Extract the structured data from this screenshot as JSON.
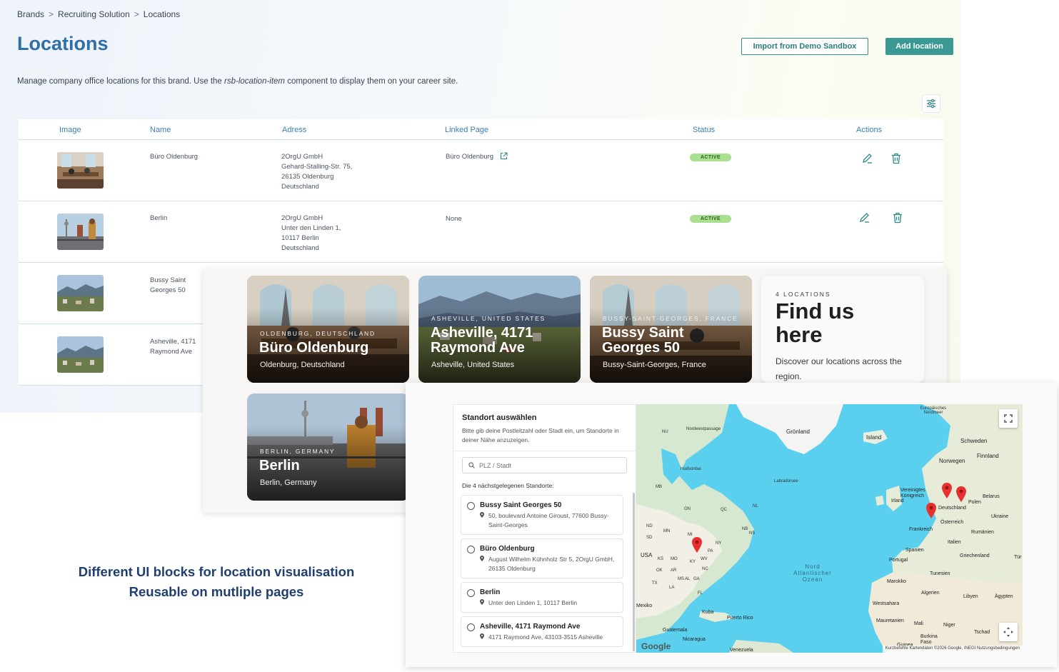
{
  "breadcrumb": {
    "items": [
      "Brands",
      "Recruiting Solution",
      "Locations"
    ],
    "separator": ">"
  },
  "page": {
    "title": "Locations",
    "description_prefix": "Manage company office locations for this brand. Use the ",
    "description_component": "rsb-location-item",
    "description_suffix": " component to display them on your career site."
  },
  "toolbar": {
    "import_label": "Import from Demo Sandbox",
    "add_label": "Add location"
  },
  "table": {
    "columns": [
      "Image",
      "Name",
      "Adress",
      "Linked Page",
      "Status",
      "Actions"
    ],
    "rows": [
      {
        "name": "Büro Oldenburg",
        "address": [
          "2OrgU GmbH",
          "Gehard-Stalling-Str. 75,",
          "26135 Oldenburg",
          "Deutschland"
        ],
        "linked_page": "Büro Oldenburg",
        "status": "ACTIVE"
      },
      {
        "name": "Berlin",
        "address": [
          "2OrgU GmbH",
          "Unter den Linden 1,",
          "10117 Berlin",
          "Deutschland"
        ],
        "linked_page": "None",
        "status": "ACTIVE"
      },
      {
        "name": "Bussy Saint Georges 50",
        "address": [],
        "linked_page": "",
        "status": ""
      },
      {
        "name": "Asheville, 4171 Raymond Ave",
        "address": [],
        "linked_page": "",
        "status": ""
      }
    ]
  },
  "cards": [
    {
      "eyebrow": "OLDENBURG, DEUTSCHLAND",
      "title": "Büro Oldenburg",
      "subtitle": "Oldenburg, Deutschland"
    },
    {
      "eyebrow": "ASHEVILLE, UNITED STATES",
      "title": "Asheville, 4171 Raymond Ave",
      "subtitle": "Asheville, United States"
    },
    {
      "eyebrow": "BUSSY-SAINT-GEORGES, FRANCE",
      "title": "Bussy Saint Georges 50",
      "subtitle": "Bussy-Saint-Georges, France"
    },
    {
      "eyebrow": "BERLIN, GERMANY",
      "title": "Berlin",
      "subtitle": "Berlin, Germany"
    }
  ],
  "find_card": {
    "eyebrow": "4 LOCATIONS",
    "title": "Find us here",
    "description": "Discover our locations across the region."
  },
  "caption": {
    "line1": "Different UI blocks for location visualisation",
    "line2": "Reusable on mutliple pages"
  },
  "location_picker": {
    "title": "Standort auswählen",
    "help": "Bitte gib deine Postleitzahl oder Stadt ein, um Standorte in deiner Nähe anzuzeigen.",
    "search_placeholder": "PLZ / Stadt",
    "count_label": "Die 4 nächstgelegenen Standorte:",
    "items": [
      {
        "name": "Bussy Saint Georges 50",
        "address": "50, boulevard Antoine Giroust, 77600 Bussy-Saint-Georges"
      },
      {
        "name": "Büro Oldenburg",
        "address": "August Wilhelm Kühnholz Str 5, 2OrgU GmbH, 26135 Oldenburg"
      },
      {
        "name": "Berlin",
        "address": "Unter den Linden 1, 10117 Berlin"
      },
      {
        "name": "Asheville, 4171 Raymond Ave",
        "address": "4171 Raymond Ave, 43103-3515 Asheville"
      }
    ]
  },
  "map": {
    "labels": {
      "groenland": "Grönland",
      "island": "Island",
      "schweden": "Schweden",
      "finnland": "Finnland",
      "norwegen": "Norwegen",
      "europaisches": "Europäisches Nordmeer",
      "nordwestpassage": "Nordwestpassage",
      "hudsonbai": "Hudsonbai",
      "labradorsee": "Labradorsee",
      "nu": "NU",
      "mb": "MB",
      "on": "ON",
      "qc": "QC",
      "nl": "NL",
      "nb": "NB",
      "ns": "NS",
      "nd": "ND",
      "mn": "MN",
      "sd": "SD",
      "mi": "MI",
      "ny": "NY",
      "pa": "PA",
      "usa": "USA",
      "ks": "KS",
      "mo": "MO",
      "ky": "KY",
      "wv": "WV",
      "ok": "OK",
      "ar": "AR",
      "nc": "NC",
      "tx": "TX",
      "ms": "MS",
      "al": "AL",
      "ga": "GA",
      "la": "LA",
      "fl": "FL",
      "vereinigtes": "Vereinigtes Königreich",
      "deutschland": "Deutschland",
      "belarus": "Belarus",
      "irland": "Irland",
      "polen": "Polen",
      "ukraine": "Ukraine",
      "frankreich": "Frankreich",
      "oesterreich": "Österreich",
      "rumaenien": "Rumänien",
      "italien": "Italien",
      "spanien": "Spanien",
      "griechenland": "Griechenland",
      "portugal": "Portugal",
      "tuerkei": "Tür",
      "tunesien": "Tunesien",
      "marokko": "Marokko",
      "algerien": "Algerien",
      "libyen": "Libyen",
      "aegypten": "Ägypten",
      "westsahara": "Westsahara",
      "mauretanien": "Mauretanien",
      "mali": "Mali",
      "niger": "Niger",
      "tschad": "Tschad",
      "burkina": "Burkina Faso",
      "guinea": "Guinea",
      "mexiko": "Mexiko",
      "kuba": "Kuba",
      "puertorico": "Puerto Rico",
      "guatemala": "Guatemala",
      "nicaragua": "Nicaragua",
      "venezuela": "Venezuela",
      "ocean": "Nord Atlantischer Ozean"
    },
    "google": "Google",
    "footer": "Kurzbefehle   Kartendaten ©2026 Google, INEGI   Nutzungsbedingungen"
  }
}
